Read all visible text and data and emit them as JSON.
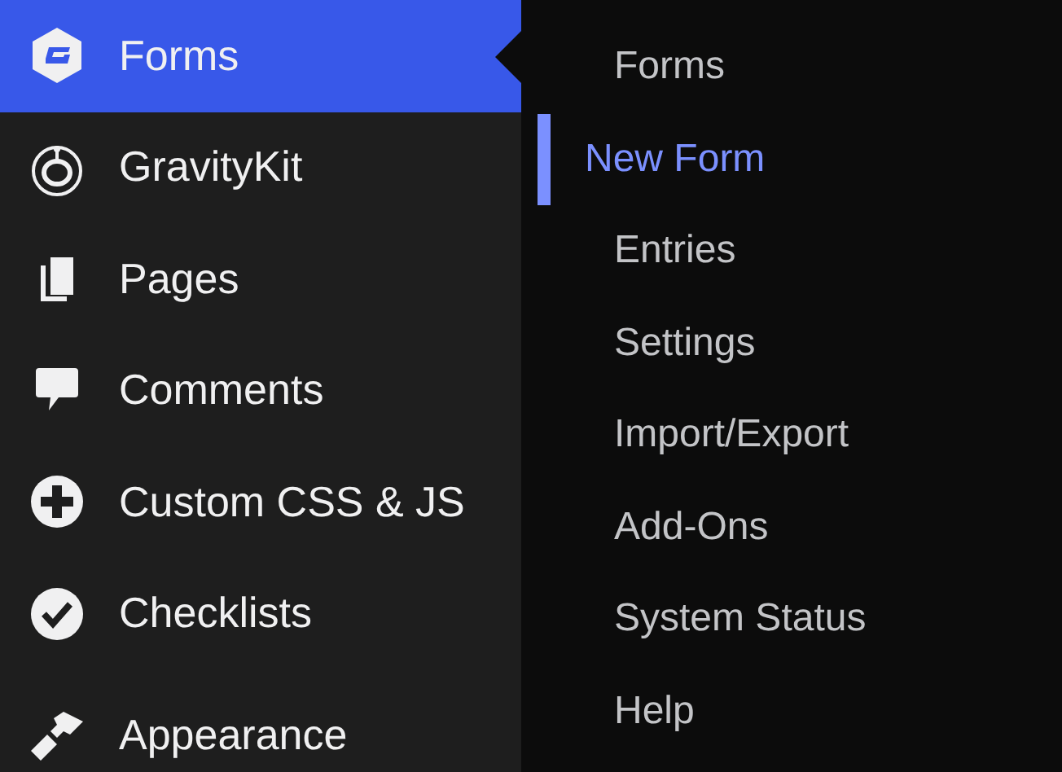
{
  "sidebar": {
    "items": [
      {
        "label": "Forms",
        "selected": true
      },
      {
        "label": "GravityKit",
        "selected": false
      },
      {
        "label": "Pages",
        "selected": false
      },
      {
        "label": "Comments",
        "selected": false
      },
      {
        "label": "Custom CSS & JS",
        "selected": false
      },
      {
        "label": "Checklists",
        "selected": false
      }
    ],
    "lower_items": [
      {
        "label": "Appearance",
        "selected": false
      }
    ]
  },
  "submenu": {
    "items": [
      {
        "label": "Forms",
        "selected": false
      },
      {
        "label": "New Form",
        "selected": true
      },
      {
        "label": "Entries",
        "selected": false
      },
      {
        "label": "Settings",
        "selected": false
      },
      {
        "label": "Import/Export",
        "selected": false
      },
      {
        "label": "Add-Ons",
        "selected": false
      },
      {
        "label": "System Status",
        "selected": false
      },
      {
        "label": "Help",
        "selected": false
      }
    ]
  }
}
